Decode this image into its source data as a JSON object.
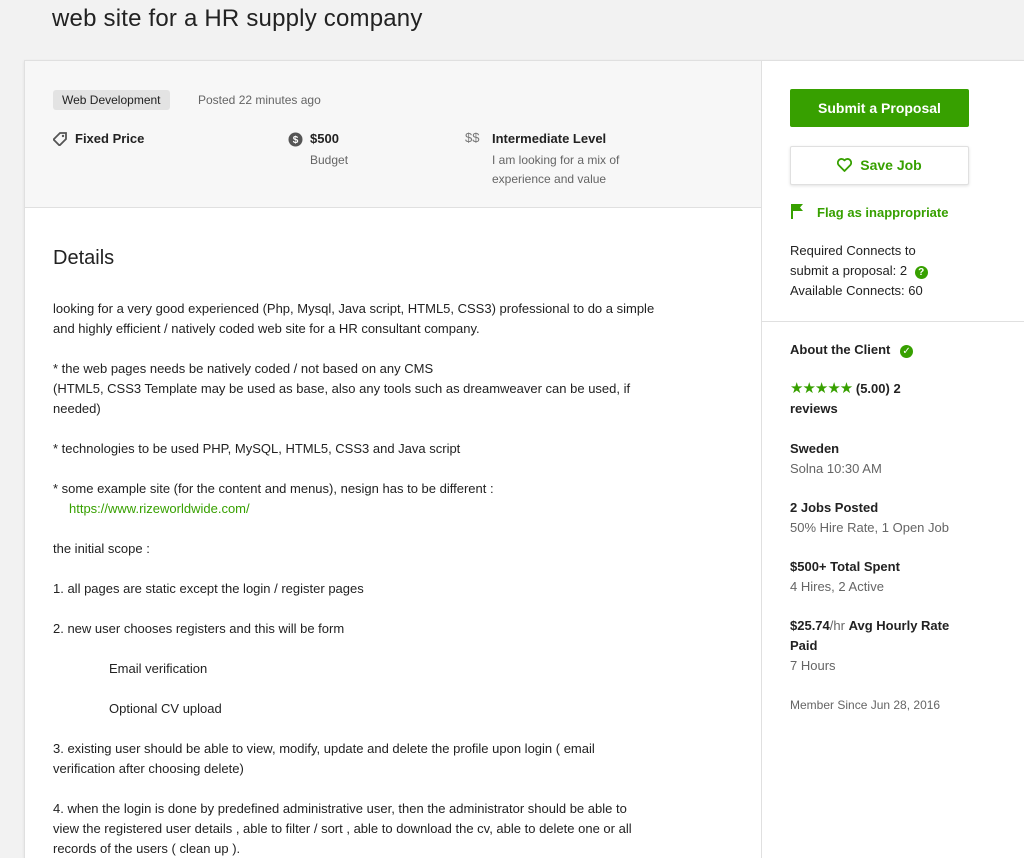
{
  "job": {
    "title": "web site for a HR supply company",
    "category": "Web Development",
    "posted": "Posted 22 minutes ago",
    "type_label": "Fixed Price",
    "budget_value": "$500",
    "budget_label": "Budget",
    "level_icon": "$$",
    "level_label": "Intermediate Level",
    "level_desc_1": "I am looking for a mix of",
    "level_desc_2": "experience and value"
  },
  "details": {
    "heading": "Details",
    "p1a": "looking for a very good experienced (Php, Mysql, Java script, HTML5, CSS3) professional to do a simple",
    "p1b": "and highly efficient / natively coded web site for a HR consultant company.",
    "p2a": "* the web pages needs be natively coded / not based on any CMS",
    "p2b": "(HTML5, CSS3 Template may be used as base, also any tools such as dreamweaver can be used, if",
    "p2c": "needed)",
    "p3": "* technologies to be used PHP, MySQL, HTML5, CSS3 and Java script",
    "p4": "* some example site (for the  content and menus), nesign has to be different :",
    "link": "https://www.rizeworldwide.com/",
    "p5": "the initial scope :",
    "p6": "1. all pages are static except the login / register pages",
    "p7": "2. new user chooses registers and this will be form",
    "p8": "Email verification",
    "p9": "Optional CV upload",
    "p10a": "3. existing user should be able to view, modify, update and delete the profile upon login ( email",
    "p10b": "verification after choosing delete)",
    "p11a": "4. when the login is done by predefined administrative user, then the administrator should be able to",
    "p11b": "view the registered user details , able to filter / sort , able to download the cv, able to delete one or all",
    "p11c": "records of the users ( clean up )."
  },
  "sidebar": {
    "submit_label": "Submit a Proposal",
    "save_label": "Save Job",
    "flag_label": "Flag as inappropriate",
    "connects_line1": "Required Connects to",
    "connects_line2": "submit a proposal: 2",
    "connects_line3": "Available Connects: 60"
  },
  "client": {
    "heading": "About the Client",
    "stars": "★★★★★",
    "rating": "(5.00) 2",
    "reviews": "reviews",
    "country": "Sweden",
    "city_time": "Solna 10:30 AM",
    "jobs_posted": "2 Jobs Posted",
    "hire_rate": "50% Hire Rate, 1 Open Job",
    "total_spent": "$500+ Total Spent",
    "hires": "4 Hires, 2 Active",
    "hourly_value": "$25.74",
    "hourly_unit": "/hr",
    "hourly_label": "Avg Hourly Rate",
    "hourly_label2": "Paid",
    "hours": "7 Hours",
    "member_since": "Member Since Jun 28, 2016"
  },
  "colors": {
    "accent": "#37a000",
    "muted": "#656565"
  },
  "icons": {
    "type": "tag-icon",
    "budget": "dollar-circle-icon",
    "save": "heart-icon",
    "flag": "flag-icon",
    "verified": "check-circle-icon",
    "help": "question-circle-icon"
  }
}
